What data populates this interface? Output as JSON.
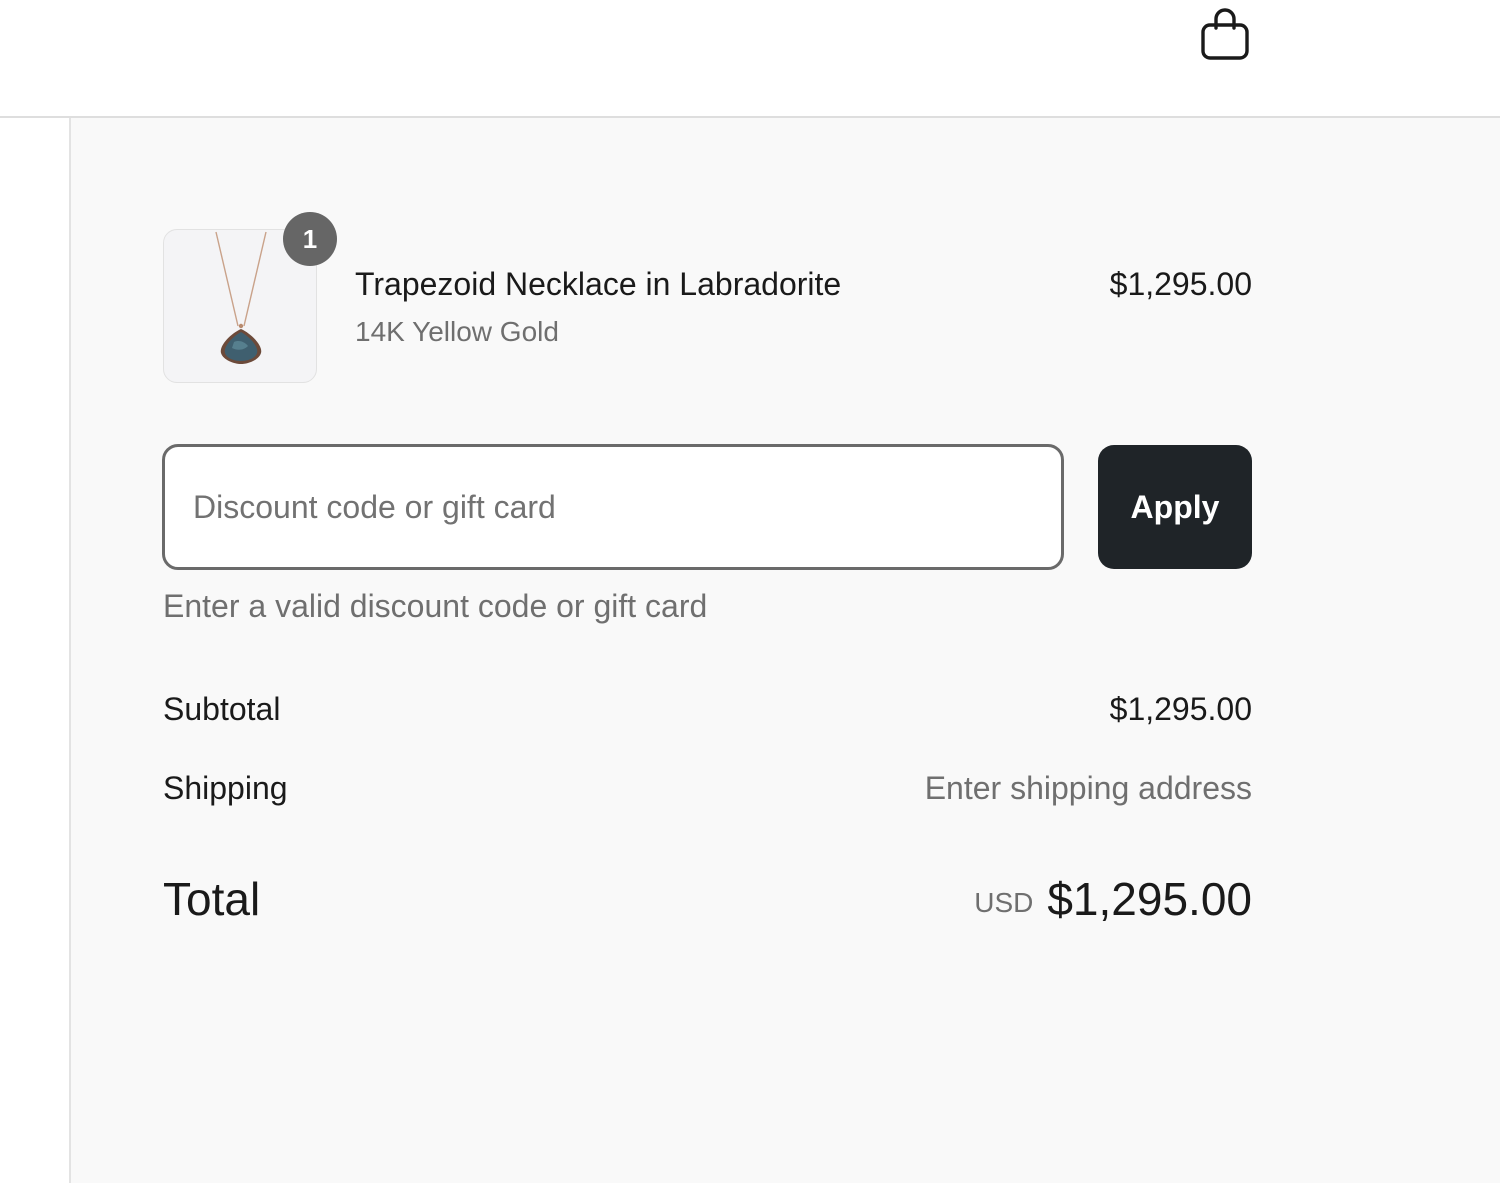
{
  "header": {
    "cart_icon": "shopping-bag-icon"
  },
  "line_item": {
    "image_icon": "necklace-image",
    "quantity": "1",
    "name": "Trapezoid Necklace in Labradorite",
    "variant": "14K Yellow Gold",
    "price": "$1,295.00"
  },
  "discount": {
    "placeholder": "Discount code or gift card",
    "value": "",
    "apply_label": "Apply",
    "error": "Enter a valid discount code or gift card"
  },
  "summary": {
    "subtotal_label": "Subtotal",
    "subtotal_value": "$1,295.00",
    "shipping_label": "Shipping",
    "shipping_value": "Enter shipping address",
    "total_label": "Total",
    "total_currency": "USD",
    "total_value": "$1,295.00"
  },
  "colors": {
    "apply_button_bg": "#1f2428",
    "badge_bg": "#666666",
    "summary_bg": "#f9f9f9",
    "muted_text": "#6f6f6f"
  }
}
